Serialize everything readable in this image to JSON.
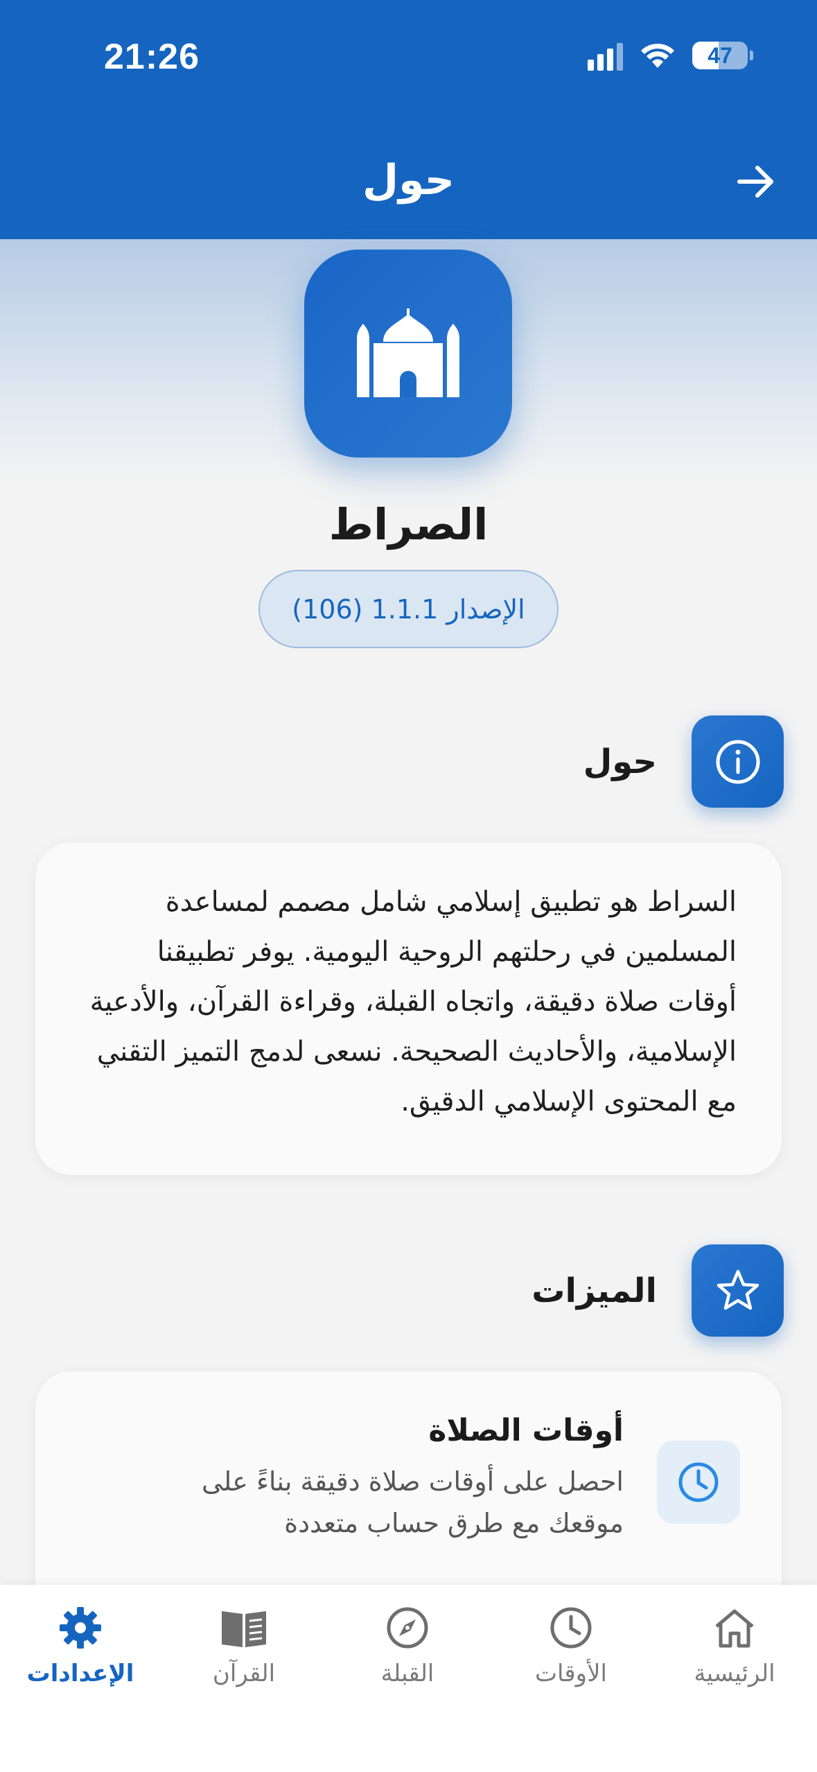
{
  "status_bar": {
    "time": "21:26",
    "battery": "47"
  },
  "header": {
    "title": "حول",
    "back_icon": "arrow-right-icon"
  },
  "hero": {
    "app_icon": "mosque-icon",
    "app_name": "الصراط",
    "version": "الإصدار 1.1.1 (106)"
  },
  "about": {
    "title": "حول",
    "icon": "info-icon",
    "text": "السراط هو تطبيق إسلامي شامل مصمم لمساعدة المسلمين في رحلتهم الروحية اليومية. يوفر تطبيقنا أوقات صلاة دقيقة، واتجاه القبلة، وقراءة القرآن، والأدعية الإسلامية، والأحاديث الصحيحة. نسعى لدمج التميز التقني مع المحتوى الإسلامي الدقيق."
  },
  "features": {
    "title": "الميزات",
    "icon": "star-icon",
    "items": [
      {
        "title": "أوقات الصلاة",
        "description": "احصل على أوقات صلاة دقيقة بناءً على موقعك مع طرق حساب متعددة",
        "icon": "clock-icon"
      }
    ]
  },
  "bottom_nav": {
    "items": [
      {
        "label": "الإعدادات",
        "icon": "gear-icon",
        "active": true
      },
      {
        "label": "القرآن",
        "icon": "book-icon",
        "active": false
      },
      {
        "label": "القبلة",
        "icon": "compass-icon",
        "active": false
      },
      {
        "label": "الأوقات",
        "icon": "clock-icon",
        "active": false
      },
      {
        "label": "الرئيسية",
        "icon": "home-icon",
        "active": false
      }
    ]
  },
  "colors": {
    "primary": "#1565c0",
    "background": "#f3f3f3",
    "card": "#fafafa"
  }
}
